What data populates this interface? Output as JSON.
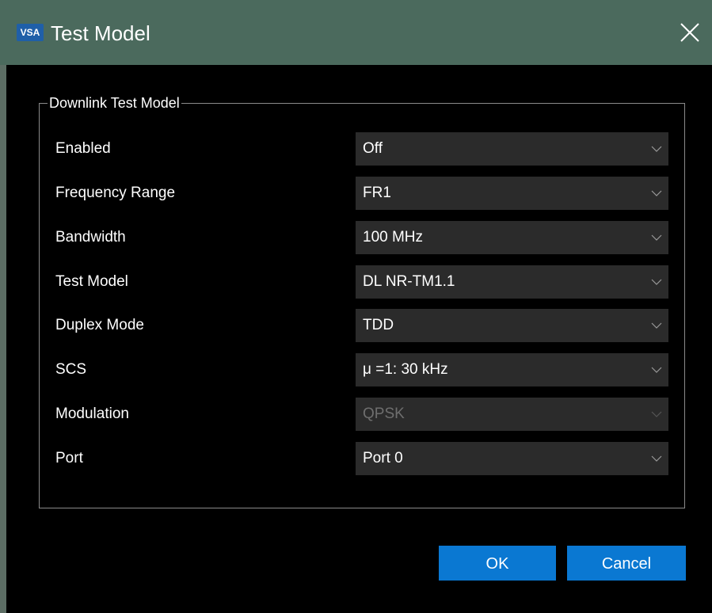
{
  "window": {
    "title": "Test Model",
    "icon_label": "VSA"
  },
  "group": {
    "legend": "Downlink Test Model"
  },
  "fields": [
    {
      "label": "Enabled",
      "value": "Off",
      "disabled": false
    },
    {
      "label": "Frequency Range",
      "value": "FR1",
      "disabled": false
    },
    {
      "label": "Bandwidth",
      "value": "100 MHz",
      "disabled": false
    },
    {
      "label": "Test Model",
      "value": "DL NR-TM1.1",
      "disabled": false
    },
    {
      "label": "Duplex Mode",
      "value": "TDD",
      "disabled": false
    },
    {
      "label": "SCS",
      "value": "μ =1: 30 kHz",
      "disabled": false
    },
    {
      "label": "Modulation",
      "value": "QPSK",
      "disabled": true
    },
    {
      "label": "Port",
      "value": "Port 0",
      "disabled": false
    }
  ],
  "buttons": {
    "ok_label": "OK",
    "cancel_label": "Cancel"
  },
  "colors": {
    "titlebar": "#4b6a5d",
    "background": "#000000",
    "field_bg": "#2b2b2b",
    "button_accent": "#0a78d2",
    "disabled_text": "#6e6e6e"
  },
  "icons": {
    "close": "close-icon",
    "dropdown": "chevron-down-icon",
    "app": "vsa-app-icon"
  }
}
